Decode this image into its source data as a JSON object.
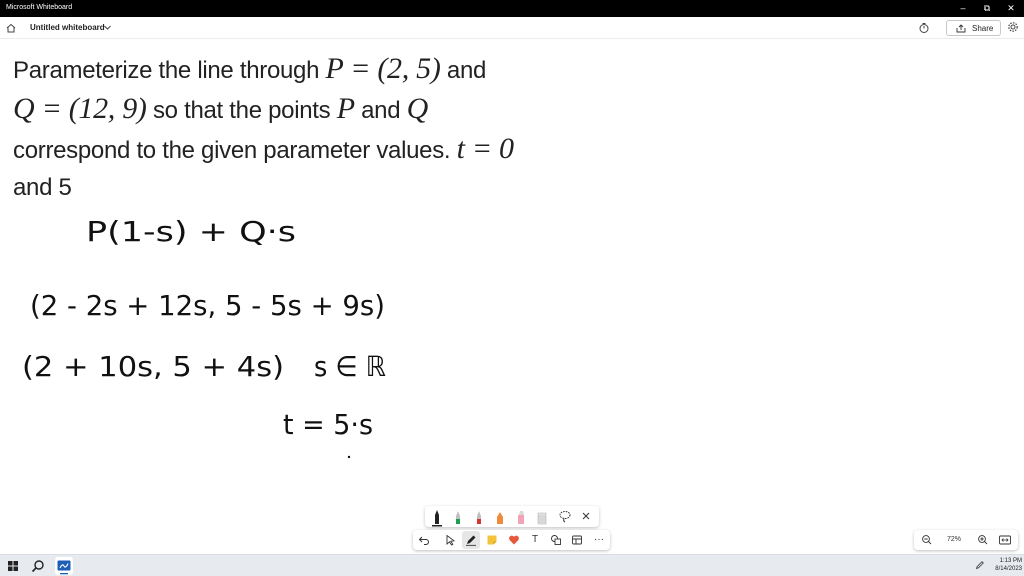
{
  "window": {
    "title": "Microsoft Whiteboard",
    "min_glyph": "–",
    "max_glyph": "⧉",
    "close_glyph": "✕"
  },
  "appbar": {
    "board_title": "Untitled whiteboard",
    "share_label": "Share"
  },
  "problem": {
    "line1_a": "Parameterize the line through ",
    "line1_math": "P = (2, 5)",
    "line1_b": " and",
    "line2_math1": "Q = (12, 9)",
    "line2_b": " so that the points ",
    "line2_math2": "P",
    "line2_c": " and ",
    "line2_math3": "Q",
    "line3_a": "correspond to the given parameter values. ",
    "line3_math": "t = 0",
    "line4": "and 5"
  },
  "handwriting": {
    "line1": "P(1-s) + Q·s",
    "line2": "(2 - 2s + 12s, 5 - 5s + 9s)",
    "line3a": "(2 + 10s, 5 + 4s)",
    "line3b": "s ∈ ℝ",
    "line4": "t = 5·s"
  },
  "toolbar": {
    "more_glyph": "···",
    "text_glyph": "T"
  },
  "zoom": {
    "level": "72%"
  },
  "taskbar": {
    "time": "1:13 PM",
    "date": "8/14/2023"
  },
  "colors": {
    "titlebar": "#000000",
    "pen_black": "#222222",
    "pen_green": "#1e9e50",
    "pen_red": "#d9342b",
    "pen_orange": "#f08a3c",
    "highlighter_pink": "#f2a3b8",
    "reaction_heart": "#e8573c",
    "note_yellow": "#f3c43a",
    "taskbar": "#e7ebf0"
  }
}
